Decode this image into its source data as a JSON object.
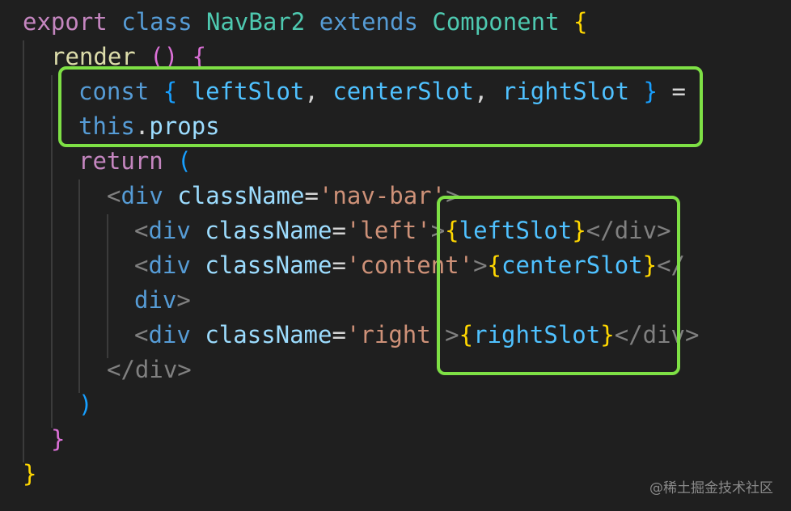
{
  "code": {
    "l1": {
      "export": "export",
      "class": "class",
      "name": "NavBar2",
      "extends": "extends",
      "base": "Component",
      "brace": "{"
    },
    "l2": {
      "fn": "render",
      "parens": "()",
      "brace": "{"
    },
    "l3": {
      "const": "const",
      "open": "{",
      "a": "leftSlot",
      "c1": ",",
      "b": "centerSlot",
      "c2": ",",
      "c": "rightSlot",
      "close": "}",
      "eq": "="
    },
    "l4": {
      "this": "this",
      "dot": ".",
      "props": "props"
    },
    "l5": {
      "ret": "return",
      "paren": "("
    },
    "l6": {
      "lt": "<",
      "tag": "div",
      "attr": "className",
      "eq": "=",
      "val": "'nav-bar'",
      "gt": ">"
    },
    "l7": {
      "lt": "<",
      "tag": "div",
      "attr": "className",
      "eq": "=",
      "val": "'left'",
      "gt": ">",
      "ob": "{",
      "expr": "leftSlot",
      "cb": "}",
      "close": "</div>"
    },
    "l8": {
      "lt": "<",
      "tag": "div",
      "attr": "className",
      "eq": "=",
      "val": "'content'",
      "gt": ">",
      "ob": "{",
      "expr": "centerSlot",
      "cb": "}",
      "close": "</"
    },
    "l9": {
      "tag": "div",
      "gt": ">"
    },
    "l10": {
      "lt": "<",
      "tag": "div",
      "attr": "className",
      "eq": "=",
      "val": "'right'",
      "gt": ">",
      "ob": "{",
      "expr": "rightSlot",
      "cb": "}",
      "close": "</div>"
    },
    "l11": {
      "close": "</div>"
    },
    "l12": {
      "paren": ")"
    },
    "l13": {
      "brace": "}"
    },
    "l14": {
      "brace": "}"
    }
  },
  "watermark": "@稀土掘金技术社区",
  "colors": {
    "highlight_box": "#7ee045",
    "background": "#1f1f1f"
  }
}
